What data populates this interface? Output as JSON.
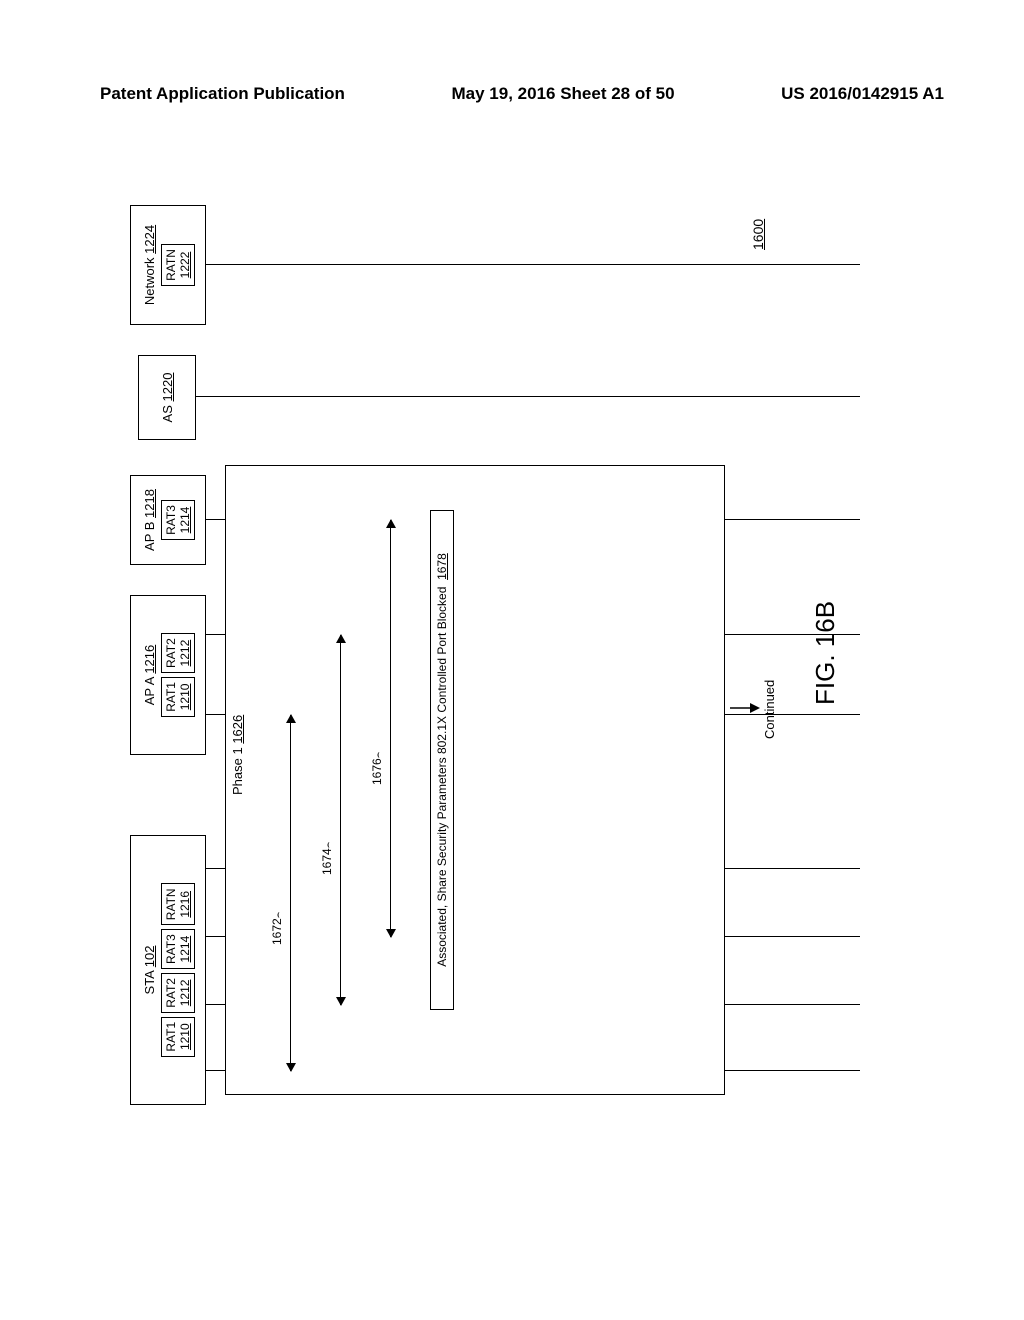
{
  "header": {
    "left": "Patent Application Publication",
    "center": "May 19, 2016  Sheet 28 of 50",
    "right": "US 2016/0142915 A1"
  },
  "entities": {
    "sta": {
      "label": "STA",
      "ref": "102"
    },
    "apa": {
      "label": "AP A",
      "ref": "1216"
    },
    "apb": {
      "label": "AP B",
      "ref": "1218"
    },
    "as": {
      "label": "AS",
      "ref": "1220"
    },
    "net": {
      "label": "Network",
      "ref": "1224"
    }
  },
  "rats": {
    "rat1": {
      "label": "RAT1",
      "ref": "1210"
    },
    "rat2": {
      "label": "RAT2",
      "ref": "1212"
    },
    "rat3": {
      "label": "RAT3",
      "ref": "1214"
    },
    "ratn": {
      "label": "RATN",
      "ref": "1216"
    },
    "apa_rat1": {
      "label": "RAT1",
      "ref": "1210"
    },
    "apa_rat2": {
      "label": "RAT2",
      "ref": "1212"
    },
    "apb_rat3": {
      "label": "RAT3",
      "ref": "1214"
    },
    "net_ratn": {
      "label": "RATN",
      "ref": "1222"
    }
  },
  "phase": {
    "label": "Phase 1",
    "ref": "1626"
  },
  "arrows": {
    "a1": {
      "ref": "1672"
    },
    "a2": {
      "ref": "1674"
    },
    "a3": {
      "ref": "1676"
    }
  },
  "assoc": {
    "text": "Associated, Share Security Parameters 802.1X Controlled Port Blocked",
    "ref": "1678"
  },
  "continued": "Continued",
  "figure_label": "FIG. 16B",
  "figure_number": "1600"
}
